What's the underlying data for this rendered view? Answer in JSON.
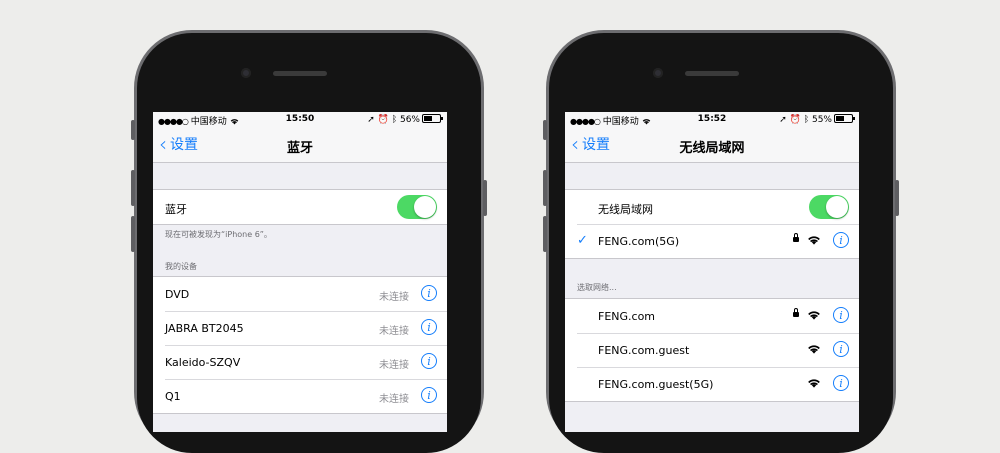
{
  "phones": [
    {
      "status": {
        "carrier": "中国移动",
        "time": "15:50",
        "battery": "56%",
        "battery_level": 0.56
      },
      "nav": {
        "back_label": "设置",
        "title": "蓝牙"
      },
      "toggle_label": "蓝牙",
      "toggle_on": true,
      "discoverable_text": "现在可被发现为“iPhone 6”。",
      "devices_header": "我的设备",
      "devices": [
        {
          "name": "DVD",
          "status": "未连接"
        },
        {
          "name": "JABRA BT2045",
          "status": "未连接"
        },
        {
          "name": "Kaleido-SZQV",
          "status": "未连接"
        },
        {
          "name": "Q1",
          "status": "未连接"
        }
      ]
    },
    {
      "status": {
        "carrier": "中国移动",
        "time": "15:52",
        "battery": "55%",
        "battery_level": 0.55
      },
      "nav": {
        "back_label": "设置",
        "title": "无线局域网"
      },
      "toggle_label": "无线局域网",
      "toggle_on": true,
      "connected": {
        "name": "FENG.com(5G)",
        "locked": true
      },
      "choose_header": "选取网络...",
      "networks": [
        {
          "name": "FENG.com",
          "locked": true
        },
        {
          "name": "FENG.com.guest",
          "locked": false
        },
        {
          "name": "FENG.com.guest(5G)",
          "locked": false
        }
      ]
    }
  ],
  "icons": {
    "info": "i",
    "check": "✓",
    "chevron": "‹"
  },
  "colors": {
    "accent": "#157efb",
    "toggle_on": "#4cd964",
    "background": "#efeff4"
  }
}
